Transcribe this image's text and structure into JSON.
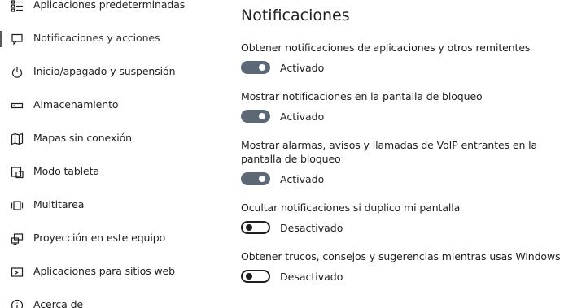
{
  "sidebar": {
    "items": [
      {
        "label": "Aplicaciones predeterminadas",
        "icon": "default-apps-icon"
      },
      {
        "label": "Notificaciones y acciones",
        "icon": "notifications-icon",
        "selected": true
      },
      {
        "label": "Inicio/apagado y suspensión",
        "icon": "power-icon"
      },
      {
        "label": "Almacenamiento",
        "icon": "storage-icon"
      },
      {
        "label": "Mapas sin conexión",
        "icon": "map-icon"
      },
      {
        "label": "Modo tableta",
        "icon": "tablet-icon"
      },
      {
        "label": "Multitarea",
        "icon": "multitask-icon"
      },
      {
        "label": "Proyección en este equipo",
        "icon": "projection-icon"
      },
      {
        "label": "Aplicaciones para sitios web",
        "icon": "web-apps-icon"
      },
      {
        "label": "Acerca de",
        "icon": "info-icon"
      }
    ]
  },
  "main": {
    "title": "Notificaciones",
    "settings": [
      {
        "label": "Obtener notificaciones de aplicaciones y otros remitentes",
        "state": "Activado",
        "on": true
      },
      {
        "label": "Mostrar notificaciones en la pantalla de bloqueo",
        "state": "Activado",
        "on": true
      },
      {
        "label": "Mostrar alarmas, avisos y llamadas de VoIP entrantes en la pantalla de bloqueo",
        "state": "Activado",
        "on": true
      },
      {
        "label": "Ocultar notificaciones si duplico mi pantalla",
        "state": "Desactivado",
        "on": false
      },
      {
        "label": "Obtener trucos, consejos y sugerencias mientras usas Windows",
        "state": "Desactivado",
        "on": false
      }
    ]
  },
  "colors": {
    "toggle_on": "#5d6876",
    "toggle_off_border": "#1f1f1f",
    "text": "#1f1f1f"
  }
}
